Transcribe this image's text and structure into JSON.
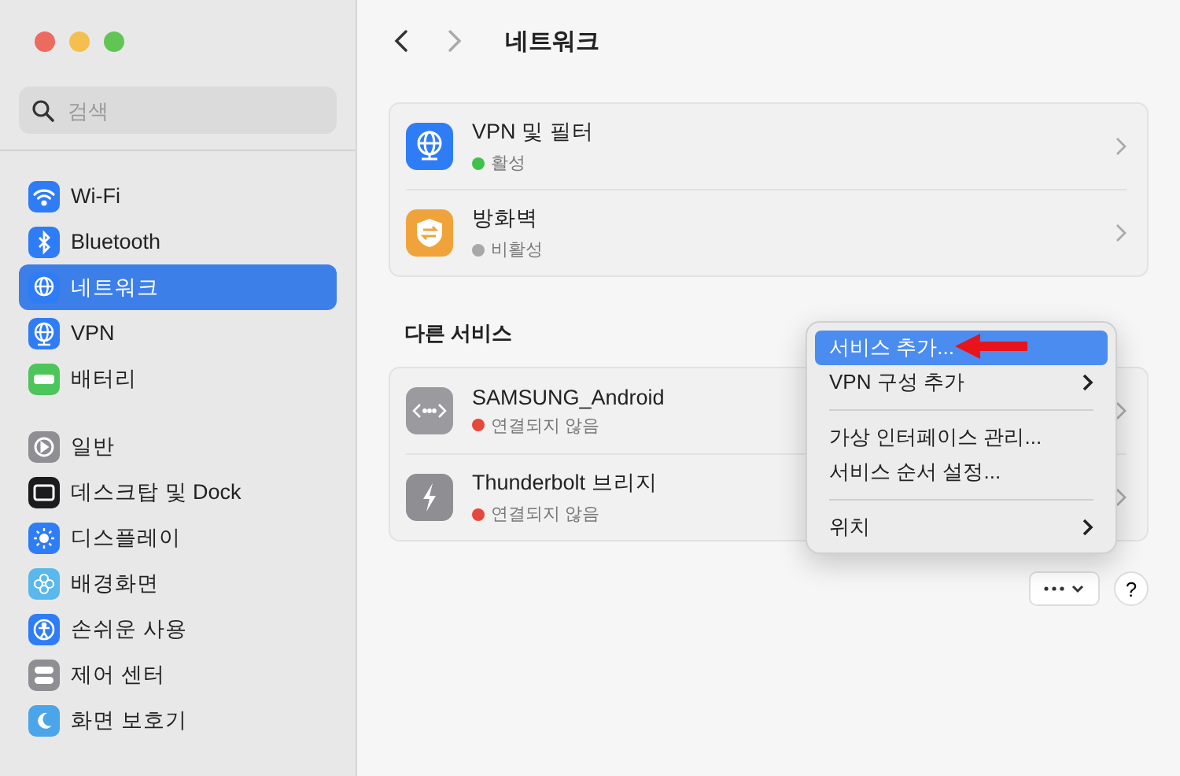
{
  "sidebar": {
    "search": {
      "placeholder": "검색"
    },
    "groups": [
      [
        {
          "label": "Wi-Fi",
          "selected": false
        },
        {
          "label": "Bluetooth",
          "selected": false
        },
        {
          "label": "네트워크",
          "selected": true
        },
        {
          "label": "VPN",
          "selected": false
        },
        {
          "label": "배터리",
          "selected": false
        }
      ],
      [
        {
          "label": "일반",
          "selected": false
        },
        {
          "label": "데스크탑 및 Dock",
          "selected": false
        },
        {
          "label": "디스플레이",
          "selected": false
        },
        {
          "label": "배경화면",
          "selected": false
        },
        {
          "label": "손쉬운 사용",
          "selected": false
        },
        {
          "label": "제어 센터",
          "selected": false
        },
        {
          "label": "화면 보호기",
          "selected": false
        }
      ]
    ]
  },
  "header": {
    "title": "네트워크"
  },
  "cards": [
    {
      "rows": [
        {
          "name": "VPN 및 필터",
          "status": "활성",
          "color": "#3fc24a"
        },
        {
          "name": "방화벽",
          "status": "비활성",
          "color": "#a8a8a8"
        }
      ]
    },
    {
      "heading": "다른 서비스",
      "rows": [
        {
          "name": "SAMSUNG_Android",
          "status": "연결되지 않음",
          "color": "#e5483c"
        },
        {
          "name": "Thunderbolt 브리지",
          "status": "연결되지 않음",
          "color": "#e5483c"
        }
      ]
    }
  ],
  "menu": [
    {
      "kind": "item",
      "label": "서비스 추가...",
      "selected": true,
      "submenu": false
    },
    {
      "kind": "item",
      "label": "VPN 구성 추가",
      "selected": false,
      "submenu": true
    },
    {
      "kind": "separator"
    },
    {
      "kind": "item",
      "label": "가상 인터페이스 관리...",
      "selected": false,
      "submenu": false
    },
    {
      "kind": "item",
      "label": "서비스 순서 설정...",
      "selected": false,
      "submenu": false
    },
    {
      "kind": "separator"
    },
    {
      "kind": "item",
      "label": "위치",
      "selected": false,
      "submenu": true
    }
  ],
  "help": {
    "label": "?"
  }
}
